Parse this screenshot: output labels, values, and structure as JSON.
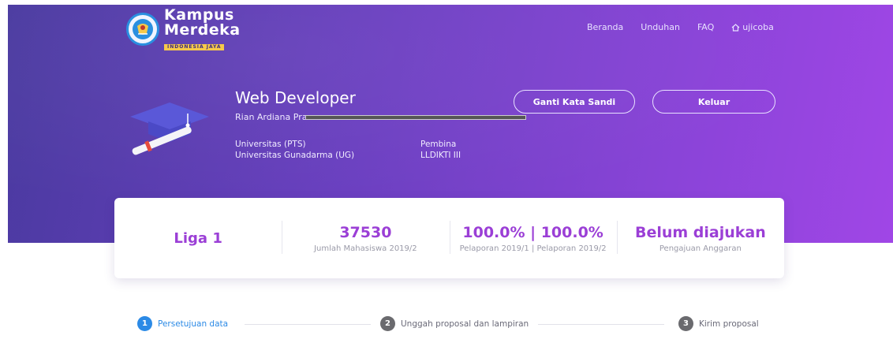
{
  "brand": {
    "line1": "Kampus",
    "line2": "Merdeka",
    "tagline": "INDONESIA JAYA"
  },
  "nav": {
    "items": [
      "Beranda",
      "Unduhan",
      "FAQ"
    ],
    "user_label": "ujicoba"
  },
  "profile": {
    "title": "Web Developer",
    "name": "Rian Ardiana Pra",
    "university_label": "Universitas (PTS)",
    "university_value": "Universitas Gunadarma (UG)",
    "pembina_label": "Pembina",
    "pembina_value": "LLDIKTI III"
  },
  "buttons": {
    "change_password": "Ganti Kata Sandi",
    "logout": "Keluar"
  },
  "stats": [
    {
      "value": "Liga 1",
      "label": ""
    },
    {
      "value": "37530",
      "label": "Jumlah Mahasiswa 2019/2"
    },
    {
      "value": "100.0% | 100.0%",
      "label": "Pelaporan 2019/1 | Pelaporan 2019/2"
    },
    {
      "value": "Belum diajukan",
      "label": "Pengajuan Anggaran"
    }
  ],
  "steps": [
    {
      "num": "1",
      "label": "Persetujuan data"
    },
    {
      "num": "2",
      "label": "Unggah proposal dan lampiran"
    },
    {
      "num": "3",
      "label": "Kirim proposal"
    }
  ],
  "colors": {
    "accent": "#9b3fd6",
    "step_active": "#2b8ae6",
    "hero_start": "#4a3aa0",
    "hero_end": "#a046e6"
  }
}
